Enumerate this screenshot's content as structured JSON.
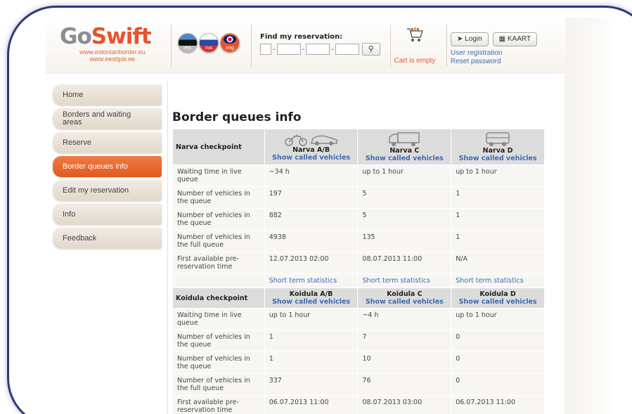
{
  "logo": {
    "go": "Go",
    "swift": "Swift",
    "url1": "www.estonianborder.eu",
    "url2": "www.eestipiir.ee"
  },
  "languages": [
    {
      "code": "est"
    },
    {
      "code": "rus"
    },
    {
      "code": "eng"
    }
  ],
  "find_reservation": {
    "label": "Find my reservation:",
    "dash": "-"
  },
  "cart": {
    "text": "Cart is empty"
  },
  "auth": {
    "login": "Login",
    "kaart": "KAART",
    "user_registration": "User registration",
    "reset_password": "Reset password"
  },
  "nav": [
    {
      "label": "Home"
    },
    {
      "label": "Borders and waiting areas"
    },
    {
      "label": "Reserve"
    },
    {
      "label": "Border queues info"
    },
    {
      "label": "Edit my reservation"
    },
    {
      "label": "Info"
    },
    {
      "label": "Feedback"
    }
  ],
  "page_title": "Border queues info",
  "narva": {
    "checkpoint": "Narva checkpoint",
    "lanes": [
      {
        "name": "Narva A/B",
        "link": "Show called vehicles"
      },
      {
        "name": "Narva C",
        "link": "Show called vehicles"
      },
      {
        "name": "Narva D",
        "link": "Show called vehicles"
      }
    ],
    "rows": [
      {
        "label": "Waiting time in live queue",
        "values": [
          "~34 h",
          "up to 1 hour",
          "up to 1 hour"
        ]
      },
      {
        "label": "Number of vehicles in the queue",
        "values": [
          "197",
          "5",
          "1"
        ]
      },
      {
        "label": "Number of vehicles in the queue",
        "values": [
          "882",
          "5",
          "1"
        ]
      },
      {
        "label": "Number of vehicles in the full queue",
        "values": [
          "4938",
          "135",
          "1"
        ]
      },
      {
        "label": "First available pre-reservation time",
        "values": [
          "12.07.2013 02:00",
          "08.07.2013 11:00",
          "N/A"
        ]
      }
    ],
    "stats": [
      "Short term statistics",
      "Short term statistics",
      "Short term statistics"
    ]
  },
  "koidula": {
    "checkpoint": "Koidula checkpoint",
    "lanes": [
      {
        "name": "Koidula A/B",
        "link": "Show called vehicles"
      },
      {
        "name": "Koidula C",
        "link": "Show called vehicles"
      },
      {
        "name": "Koidula D",
        "link": "Show called vehicles"
      }
    ],
    "rows": [
      {
        "label": "Waiting time in live queue",
        "values": [
          "up to 1 hour",
          "~4 h",
          "up to 1 hour"
        ]
      },
      {
        "label": "Number of vehicles in the queue",
        "values": [
          "1",
          "7",
          "0"
        ]
      },
      {
        "label": "Number of vehicles in the queue",
        "values": [
          "1",
          "10",
          "0"
        ]
      },
      {
        "label": "Number of vehicles in the full queue",
        "values": [
          "337",
          "76",
          "0"
        ]
      },
      {
        "label": "First available pre-reservation time",
        "values": [
          "06.07.2013 11:00",
          "08.07.2013 03:00",
          "06.07.2013 11:00"
        ]
      }
    ]
  },
  "colors": {
    "accent": "#e8532c",
    "link": "#3d6ab0",
    "frame": "#2b3a78"
  }
}
